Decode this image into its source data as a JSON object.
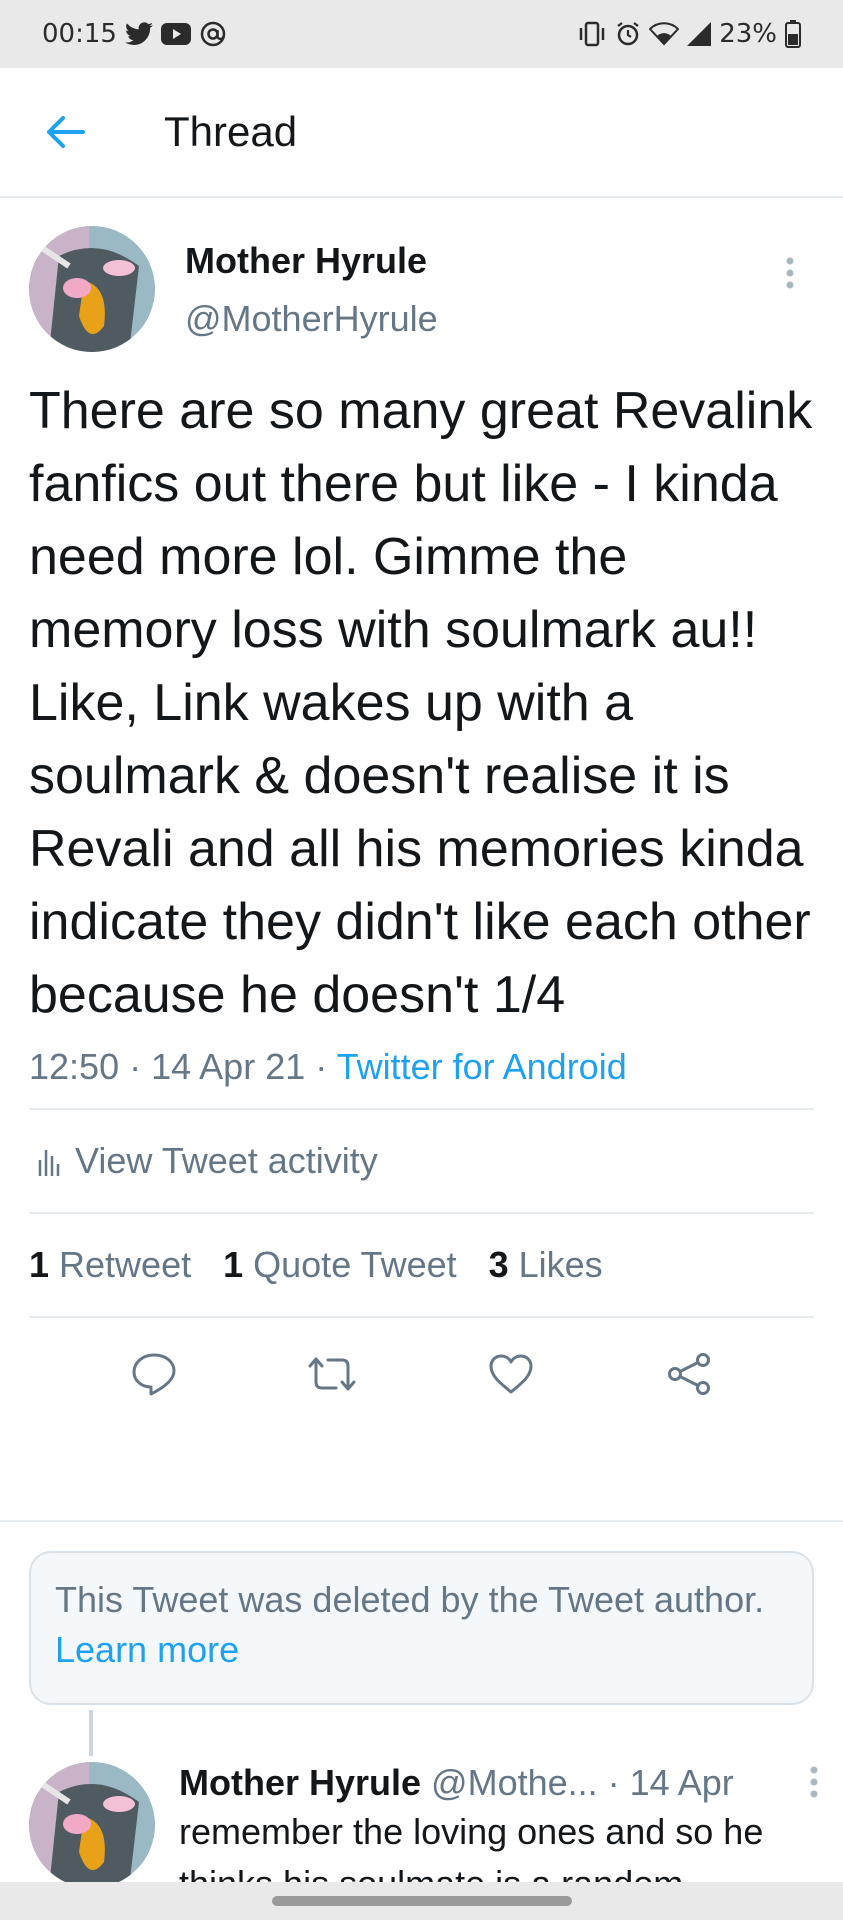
{
  "status_bar": {
    "time": "00:15",
    "battery": "23%"
  },
  "header": {
    "title": "Thread"
  },
  "tweet": {
    "author_name": "Mother Hyrule",
    "author_handle": "@MotherHyrule",
    "text": "There are so many great Revalink fanfics out there but like - I kinda need more lol. Gimme the memory loss with soulmark au!! Like, Link wakes up with a soulmark & doesn't realise it is Revali and all his memories kinda indicate they didn't like each other because he doesn't 1/4",
    "time": "12:50",
    "date": "14 Apr 21",
    "source": "Twitter for Android",
    "activity_label": "View Tweet activity",
    "retweets_count": "1",
    "retweets_label": "Retweet",
    "quote_count": "1",
    "quote_label": "Quote Tweet",
    "likes_count": "3",
    "likes_label": "Likes"
  },
  "deleted_notice": {
    "text": "This Tweet was deleted by the Tweet author.",
    "link": "Learn more"
  },
  "reply": {
    "author_name": "Mother Hyrule",
    "author_handle": "@Mothe...",
    "date": "· 14 Apr",
    "text": "remember the loving ones and so he thinks his soulmate is a random"
  },
  "colors": {
    "accent": "#1da1f2",
    "text_primary": "#14171a",
    "text_secondary": "#657786",
    "divider": "#e6ecf0"
  }
}
